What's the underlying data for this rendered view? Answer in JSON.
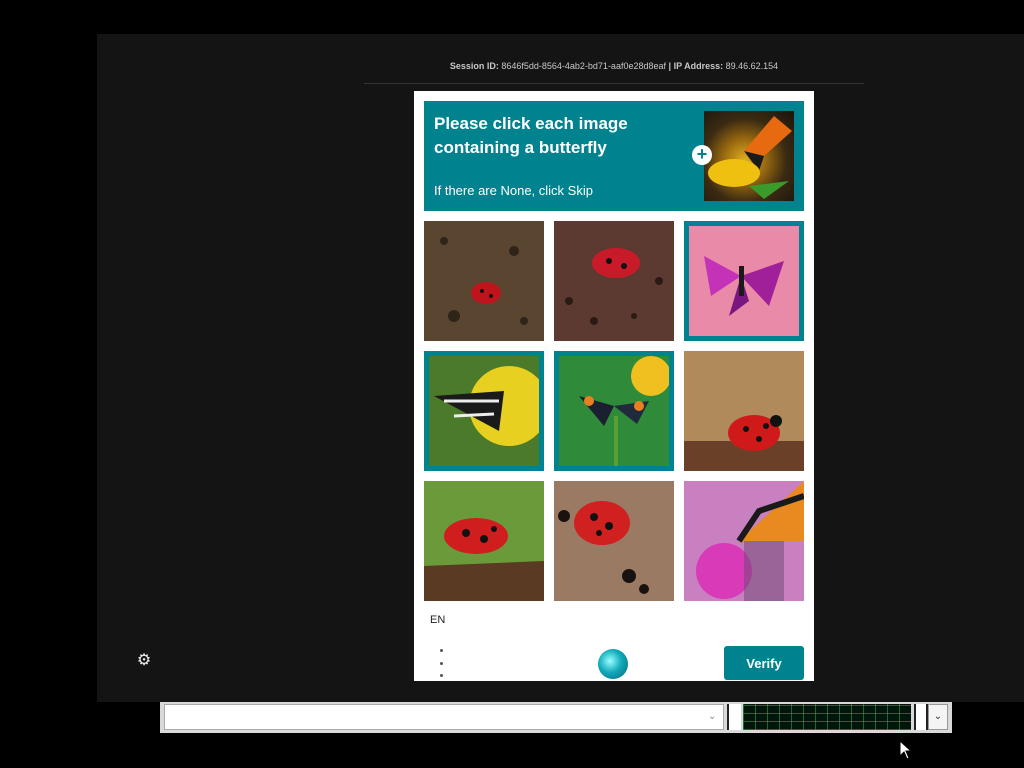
{
  "session": {
    "session_label": "Session ID:",
    "session_id": "8646f5dd-8564-4ab2-bd71-aaf0e28d8eaf",
    "separator": "|",
    "ip_label": "IP Address:",
    "ip_address": "89.46.62.154"
  },
  "captcha": {
    "prompt_title": "Please click each image containing a butterfly",
    "prompt_sub": "If there are None, click Skip",
    "add_icon": "+",
    "language": "EN",
    "verify_label": "Verify",
    "accent_color": "#00838f",
    "tiles": [
      {
        "subject": "ladybug",
        "selected": false
      },
      {
        "subject": "ladybug",
        "selected": false
      },
      {
        "subject": "butterfly",
        "selected": true
      },
      {
        "subject": "butterfly",
        "selected": true
      },
      {
        "subject": "butterfly",
        "selected": true
      },
      {
        "subject": "ladybug",
        "selected": false
      },
      {
        "subject": "ladybug",
        "selected": false
      },
      {
        "subject": "ladybug",
        "selected": false
      },
      {
        "subject": "butterfly",
        "selected": false
      }
    ]
  },
  "icons": {
    "settings": "gear-icon",
    "menu": "more-vertical-icon",
    "logo": "hcaptcha-logo-icon",
    "dropdown": "chevron-down-icon"
  },
  "bottom_bar": {
    "field_value": "",
    "dropdown_glyph": "⌄"
  }
}
